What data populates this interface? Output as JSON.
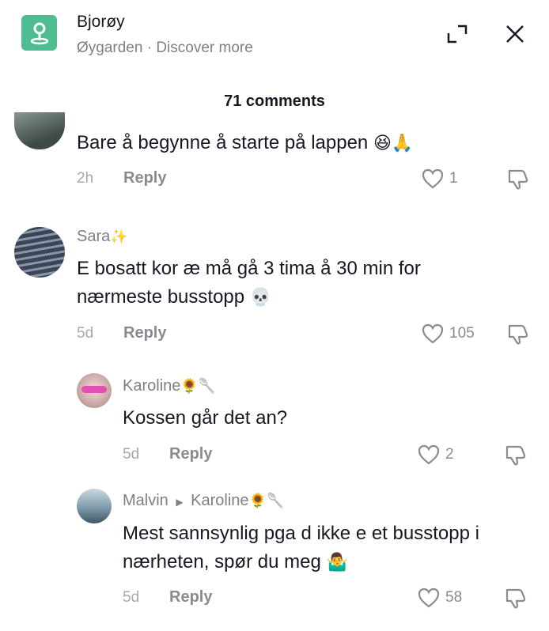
{
  "header": {
    "title": "Bjorøy",
    "subtitle": "Øygarden · Discover more"
  },
  "comments_count": "71 comments",
  "comments": [
    {
      "text": "Bare å begynne å starte på lappen",
      "emojis": "😆🙏",
      "time": "2h",
      "reply": "Reply",
      "likes": "1"
    },
    {
      "username": "Sara",
      "username_emoji": "✨",
      "text": "E bosatt kor æ må gå 3 tima å 30 min for nærmeste busstopp",
      "emojis": "💀",
      "time": "5d",
      "reply": "Reply",
      "likes": "105"
    },
    {
      "username": "Karoline",
      "username_emoji": "🌻🥄",
      "text": "Kossen går det an?",
      "time": "5d",
      "reply": "Reply",
      "likes": "2"
    },
    {
      "username": "Malvin",
      "reply_to": "Karoline",
      "reply_to_emoji": "🌻🥄",
      "text": "Mest sannsynlig pga d ikke e et busstopp i nærheten, spør du meg",
      "emojis": "🤷‍♂️",
      "time": "5d",
      "reply": "Reply",
      "likes": "58"
    }
  ]
}
